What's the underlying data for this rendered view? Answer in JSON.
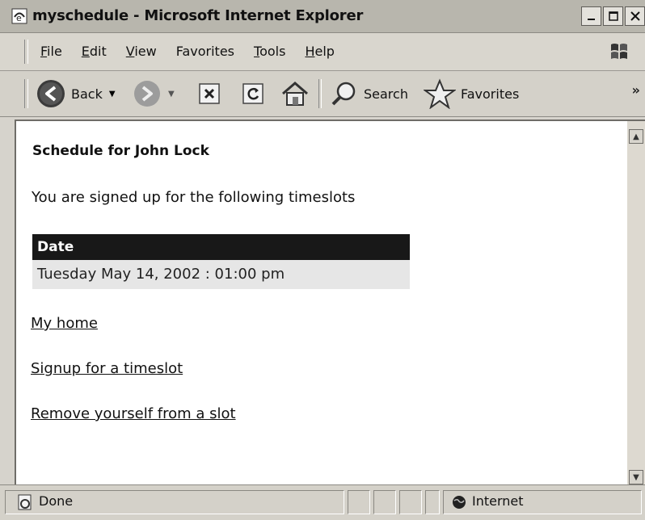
{
  "window": {
    "title": "myschedule - Microsoft Internet Explorer"
  },
  "menu": {
    "items": [
      "File",
      "Edit",
      "View",
      "Favorites",
      "Tools",
      "Help"
    ]
  },
  "toolbar": {
    "back_label": "Back",
    "search_label": "Search",
    "favorites_label": "Favorites",
    "more_label": "»"
  },
  "page": {
    "heading": "Schedule for John Lock",
    "intro": "You are signed up for the following timeslots",
    "table": {
      "headers": [
        "Date"
      ],
      "rows": [
        [
          "Tuesday May 14, 2002 : 01:00 pm"
        ]
      ]
    },
    "links": [
      "My home",
      "Signup for a timeslot",
      "Remove yourself from a slot"
    ]
  },
  "status": {
    "text": "Done",
    "zone": "Internet"
  },
  "colors": {
    "table_header_bg": "#181818",
    "table_row_bg": "#e6e6e6",
    "titlebar_bg": "#b8b6ad"
  }
}
